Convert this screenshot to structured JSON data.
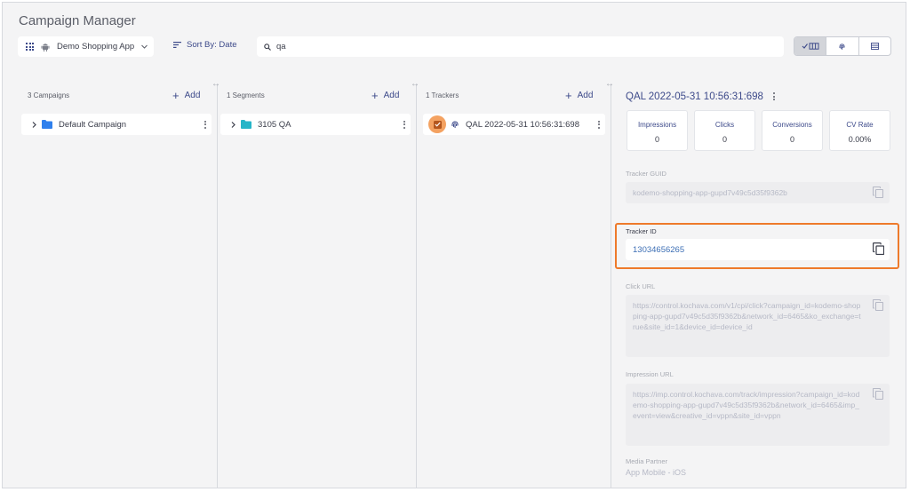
{
  "app": {
    "title": "Campaign Manager"
  },
  "toolbar": {
    "app_name": "Demo Shopping App",
    "sort_label": "Sort By: Date",
    "search_value": "qa",
    "icons": {
      "grid": "apps-grid-icon",
      "platform": "android-icon",
      "dropdown": "chevron-down-icon",
      "sort": "sort-icon",
      "search": "search-icon"
    },
    "view_toggle": [
      "check-columns-view-icon",
      "fingerprint-icon",
      "list-view-icon"
    ]
  },
  "columns": {
    "campaigns": {
      "count_label": "3 Campaigns",
      "add_label": "Add",
      "items": [
        {
          "label": "Default Campaign",
          "folder_color": "#2f80ed"
        }
      ]
    },
    "segments": {
      "count_label": "1 Segments",
      "add_label": "Add",
      "items": [
        {
          "label": "3105 QA",
          "folder_color": "#26b5c8"
        }
      ]
    },
    "trackers": {
      "count_label": "1 Trackers",
      "add_label": "Add",
      "items": [
        {
          "label": "QAL 2022-05-31 10:56:31:698",
          "checked": true
        }
      ]
    }
  },
  "detail": {
    "title": "QAL 2022-05-31 10:56:31:698",
    "stats": [
      {
        "label": "Impressions",
        "value": "0"
      },
      {
        "label": "Clicks",
        "value": "0"
      },
      {
        "label": "Conversions",
        "value": "0"
      },
      {
        "label": "CV Rate",
        "value": "0.00%"
      }
    ],
    "tracker_guid": {
      "label": "Tracker GUID",
      "value": "kodemo-shopping-app-gupd7v49c5d35f9362b"
    },
    "tracker_id": {
      "label": "Tracker ID",
      "value": "13034656265"
    },
    "click_url": {
      "label": "Click URL",
      "value": "https://control.kochava.com/v1/cpi/click?campaign_id=kodemo-shopping-app-gupd7v49c5d35f9362b&network_id=6465&ko_exchange=true&site_id=1&device_id=device_id"
    },
    "impression_url": {
      "label": "Impression URL",
      "value": "https://imp.control.kochava.com/track/impression?campaign_id=kodemo-shopping-app-gupd7v49c5d35f9362b&network_id=6465&imp_event=view&creative_id=vppn&site_id=vppn"
    },
    "media_partner": {
      "label": "Media Partner",
      "value": "App Mobile - iOS"
    }
  },
  "colors": {
    "accent": "#3d4a8a",
    "highlight_outline": "#ee7a2b",
    "tracker_id_text": "#3d6fb5",
    "checkbox_bg": "#f4a261"
  }
}
